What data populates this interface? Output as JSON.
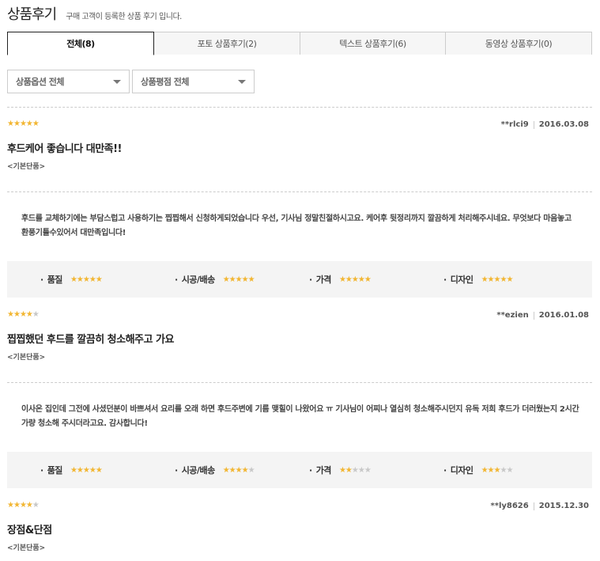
{
  "header": {
    "title": "상품후기",
    "subtitle": "구매 고객이 등록한 상품 후기 입니다."
  },
  "tabs": [
    {
      "label": "전체(8)",
      "active": true
    },
    {
      "label": "포토 상품후기(2)",
      "active": false
    },
    {
      "label": "텍스트 상품후기(6)",
      "active": false
    },
    {
      "label": "동영상 상품후기(0)",
      "active": false
    }
  ],
  "filters": {
    "option": "상품옵션 전체",
    "rating": "상품평점 전체"
  },
  "rating_labels": {
    "quality": "품질",
    "delivery": "시공/배송",
    "price": "가격",
    "design": "디자인"
  },
  "reviews": [
    {
      "stars": 5,
      "user": "**rlci9",
      "date": "2016.03.08",
      "title": "후드케어 좋습니다 대만족!!",
      "option": "<기본단품>",
      "body": "후드를 교체하기에는 부담스럽고 사용하기는 찝찝해서 신청하게되었습니다 우선, 기사님 정말친절하시고요. 케어후 뒷정리까지 깔끔하게 처리해주시네요. 무엇보다 마음놓고 환풍기틀수있어서 대만족입니다!",
      "ratings": {
        "quality": 5,
        "delivery": 5,
        "price": 5,
        "design": 5
      }
    },
    {
      "stars": 4,
      "user": "**ezien",
      "date": "2016.01.08",
      "title": "찝찝했던 후드를 깔끔히 청소해주고 가요",
      "option": "<기본단품>",
      "body": "이사온 집인데 그전에 사셨던분이 바쁘셔서 요리를 오래 하면 후드주변에 기름 맺힐이 나왔어요 ㅠ 기사님이 어찌나 열심히 청소해주시던지 유독 저희 후드가 더러웠는지 2시간가량 청소해 주시더라고요. 감사합니다!",
      "ratings": {
        "quality": 5,
        "delivery": 4,
        "price": 2,
        "design": 3
      }
    },
    {
      "stars": 4,
      "user": "**ly8626",
      "date": "2015.12.30",
      "title": "장점&단점",
      "option": "<기본단품>"
    }
  ]
}
